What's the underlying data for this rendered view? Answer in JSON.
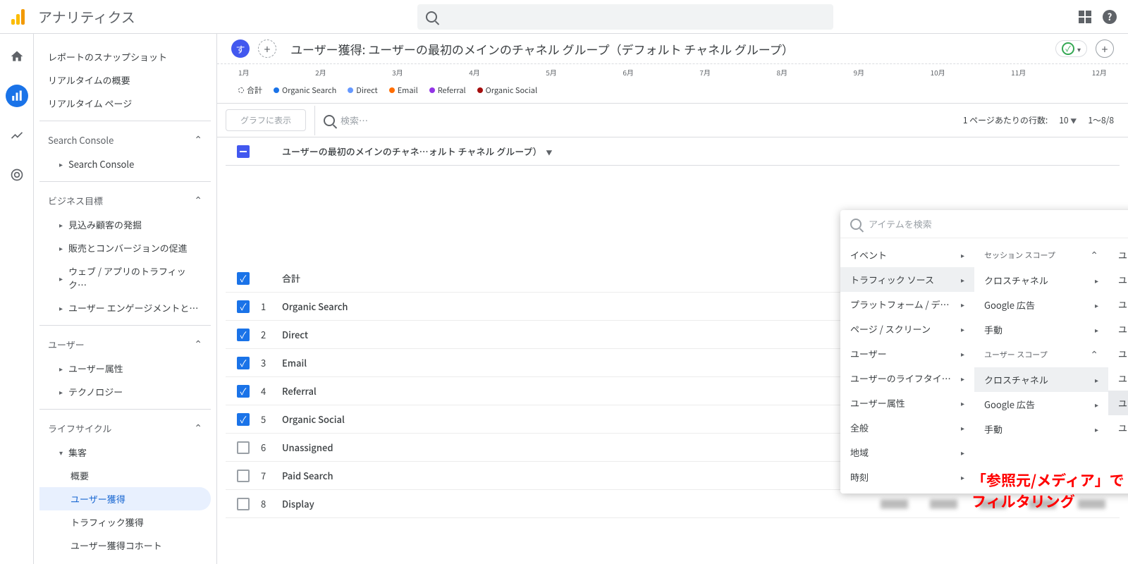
{
  "app_title": "アナリティクス",
  "sidebar": {
    "snapshot": "レポートのスナップショット",
    "rt_overview": "リアルタイムの概要",
    "rt_page": "リアルタイム ページ",
    "sc_section": "Search Console",
    "sc_item": "Search Console",
    "biz_section": "ビジネス目標",
    "biz_leads": "見込み顧客の発掘",
    "biz_conv": "販売とコンバージョンの促進",
    "biz_traffic": "ウェブ / アプリのトラフィック…",
    "biz_engage": "ユーザー エンゲージメントと…",
    "user_section": "ユーザー",
    "user_attr": "ユーザー属性",
    "user_tech": "テクノロジー",
    "life_section": "ライフサイクル",
    "life_acq": "集客",
    "life_overview": "概要",
    "life_useracq": "ユーザー獲得",
    "life_trafficacq": "トラフィック獲得",
    "life_cohort": "ユーザー獲得コホート"
  },
  "header": {
    "badge": "す",
    "title": "ユーザー獲得: ユーザーの最初のメインのチャネル グループ（デフォルト チャネル グループ）"
  },
  "timeline": [
    "1月",
    "2月",
    "3月",
    "4月",
    "5月",
    "6月",
    "7月",
    "8月",
    "9月",
    "10月",
    "11月",
    "12月"
  ],
  "legend": [
    "合計",
    "Organic Search",
    "Direct",
    "Email",
    "Referral",
    "Organic Social"
  ],
  "legend_colors": [
    "dashed",
    "#1a73e8",
    "#6699ff",
    "#ff6d01",
    "#9334e6",
    "#a50e0e"
  ],
  "controls": {
    "graph_btn": "グラフに表示",
    "search_ph": "検索…",
    "rows_label": "1 ページあたりの行数:",
    "rows_value": "10",
    "range": "1～8/8"
  },
  "table": {
    "col_header": "ユーザーの最初のメインのチャネ…ォルト チャネル グループ）",
    "total_label": "合計",
    "rows": [
      {
        "idx": "1",
        "name": "Organic Search",
        "checked": true
      },
      {
        "idx": "2",
        "name": "Direct",
        "checked": true
      },
      {
        "idx": "3",
        "name": "Email",
        "checked": true
      },
      {
        "idx": "4",
        "name": "Referral",
        "checked": true
      },
      {
        "idx": "5",
        "name": "Organic Social",
        "checked": true
      },
      {
        "idx": "6",
        "name": "Unassigned",
        "checked": false
      },
      {
        "idx": "7",
        "name": "Paid Search",
        "checked": false
      },
      {
        "idx": "8",
        "name": "Display",
        "checked": false
      }
    ]
  },
  "popover": {
    "search_ph": "アイテムを検索",
    "col1": [
      "イベント",
      "トラフィック ソース",
      "プラットフォーム / デ…",
      "ページ / スクリーン",
      "ユーザー",
      "ユーザーのライフタイ…",
      "ユーザー属性",
      "全般",
      "地域",
      "時刻"
    ],
    "col2_label1": "セッション スコープ",
    "col2a": [
      "クロスチャネル",
      "Google 広告",
      "手動"
    ],
    "col2_label2": "ユーザー スコープ",
    "col2b": [
      "クロスチャネル",
      "Google 広告",
      "手動"
    ],
    "col3": [
      "ユーザーの最初のキャンペーン",
      "ユーザーの最初のキャンペーン ID",
      "ユーザーの最初のデフォルト チャネル …",
      "ユーザーの最初のメインのチャネル グル…",
      "ユーザーの最初のメディア",
      "ユーザーの最初の参照元",
      "ユーザーの最初の参照元 / メディア",
      "ユーザーの最初の参照元プラットフォー…"
    ]
  },
  "annotation": "「参照元/メディア」でフィルタリング"
}
